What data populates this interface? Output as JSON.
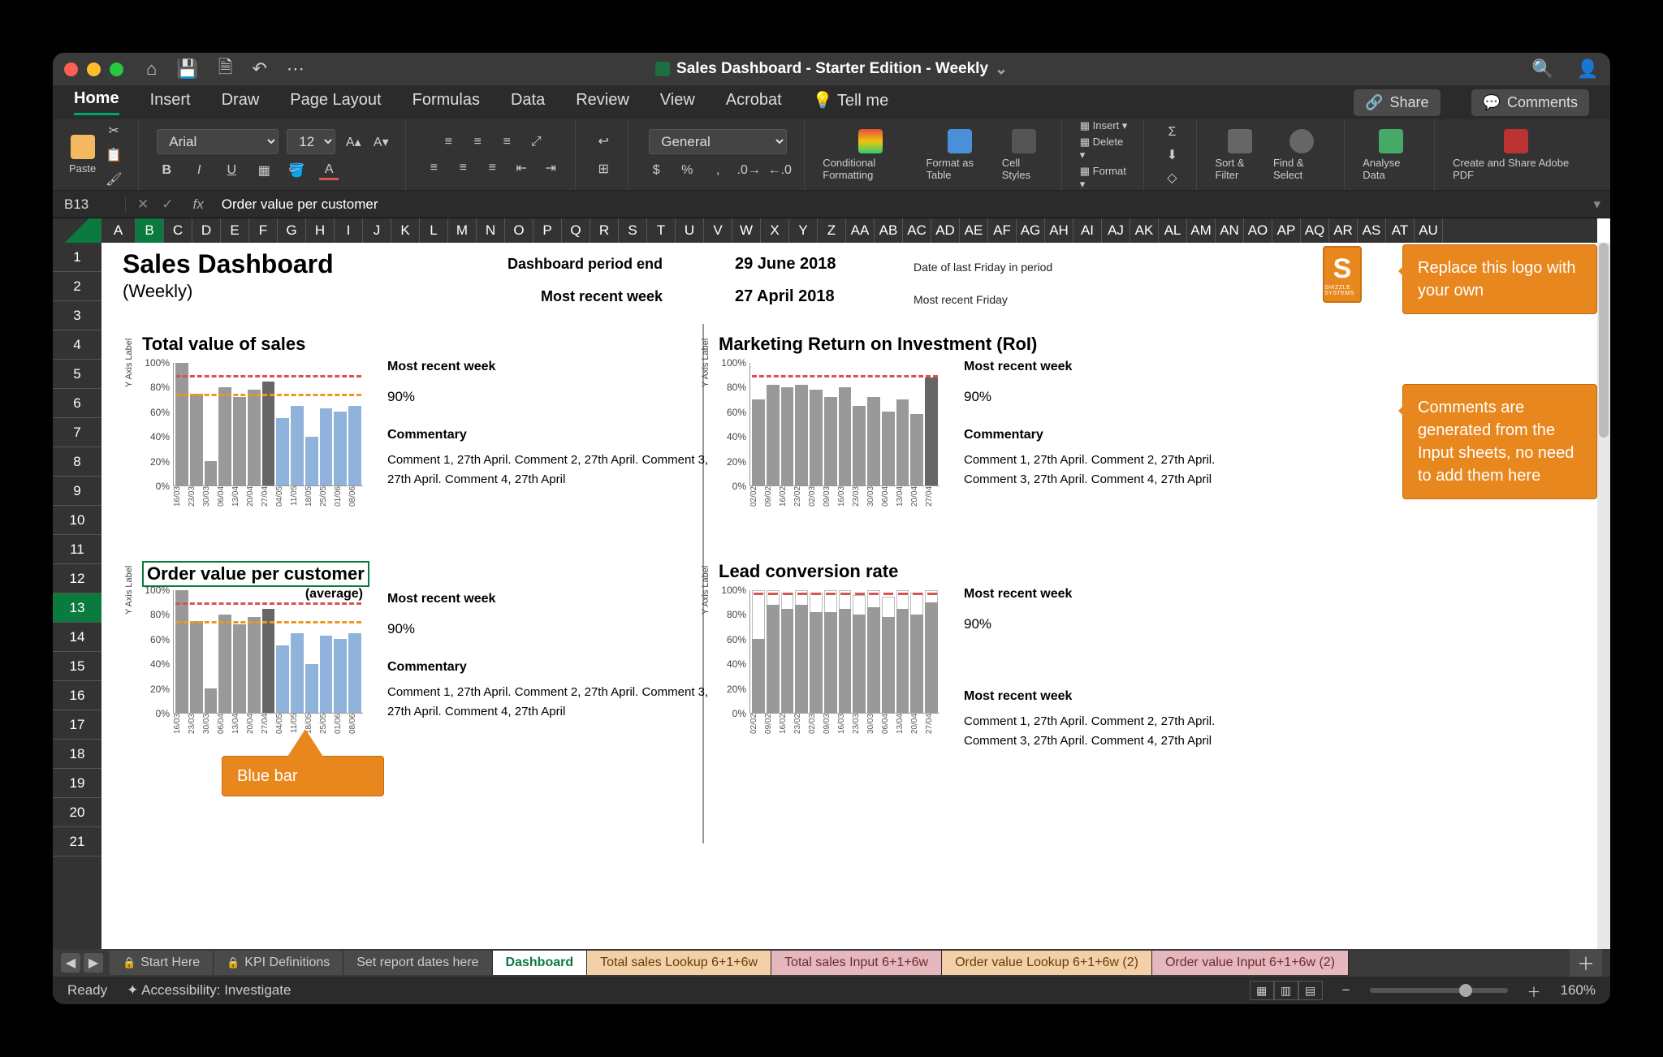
{
  "title": "Sales Dashboard - Starter Edition - Weekly",
  "tabs": [
    "Home",
    "Insert",
    "Draw",
    "Page Layout",
    "Formulas",
    "Data",
    "Review",
    "View",
    "Acrobat",
    "Tell me"
  ],
  "activeTab": "Home",
  "share": "Share",
  "comments": "Comments",
  "font": {
    "name": "Arial",
    "size": "12"
  },
  "numfmt": "General",
  "ribbon": {
    "paste": "Paste",
    "cond": "Conditional Formatting",
    "fat": "Format as Table",
    "cell": "Cell Styles",
    "insert": "Insert",
    "delete": "Delete",
    "format": "Format",
    "sort": "Sort & Filter",
    "find": "Find & Select",
    "analyse": "Analyse Data",
    "pdf": "Create and Share Adobe PDF"
  },
  "cellref": "B13",
  "formula": "Order value per customer",
  "cols": [
    "A",
    "B",
    "C",
    "D",
    "E",
    "F",
    "G",
    "H",
    "I",
    "J",
    "K",
    "L",
    "M",
    "N",
    "O",
    "P",
    "Q",
    "R",
    "S",
    "T",
    "U",
    "V",
    "W",
    "X",
    "Y",
    "Z",
    "AA",
    "AB",
    "AC",
    "AD",
    "AE",
    "AF",
    "AG",
    "AH",
    "AI",
    "AJ",
    "AK",
    "AL",
    "AM",
    "AN",
    "AO",
    "AP",
    "AQ",
    "AR",
    "AS",
    "AT",
    "AU"
  ],
  "rows": [
    "1",
    "2",
    "3",
    "4",
    "5",
    "6",
    "7",
    "8",
    "9",
    "10",
    "11",
    "12",
    "13",
    "14",
    "15",
    "16",
    "17",
    "18",
    "19",
    "20",
    "21"
  ],
  "selrow": "13",
  "dash": {
    "title": "Sales Dashboard",
    "subtitle": "(Weekly)",
    "meta1l": "Dashboard period end",
    "meta1v": "29 June 2018",
    "meta1n": "Date of last Friday in period",
    "meta2l": "Most recent week",
    "meta2v": "27 April 2018",
    "meta2n": "Most recent Friday",
    "mrw": "Most recent week",
    "pct": "90%",
    "cmh": "Commentary",
    "cmt": "Comment 1, 27th April. Comment 2,  27th April. Comment 3,  27th April. Comment 4,  27th April",
    "p1": "Total value of sales",
    "p2": "Marketing Return on Investment (RoI)",
    "p3": "Order value per customer",
    "p3s": "(average)",
    "p4": "Lead conversion rate",
    "ylab": "Y Axis Label",
    "callout_logo": "Replace this logo with your own",
    "callout_cm": "Comments are generated from the Input sheets, no need to add them here",
    "callout_blue": "Blue bar"
  },
  "chart_data": [
    {
      "id": "total_sales",
      "type": "bar",
      "title": "Total value of sales",
      "ylabel": "Y Axis Label",
      "ylim": [
        0,
        100
      ],
      "categories": [
        "16/03",
        "23/03",
        "30/03",
        "06/04",
        "13/04",
        "20/04",
        "27/04",
        "04/05",
        "11/05",
        "18/05",
        "25/05",
        "01/06",
        "08/06"
      ],
      "values": [
        100,
        75,
        20,
        80,
        72,
        78,
        85,
        55,
        65,
        40,
        63,
        60,
        65
      ],
      "forecast_start_index": 7,
      "target_line": 90,
      "mid_line": 75
    },
    {
      "id": "roi",
      "type": "bar",
      "title": "Marketing Return on Investment (RoI)",
      "ylabel": "Y Axis Label",
      "ylim": [
        0,
        100
      ],
      "categories": [
        "02/02",
        "09/02",
        "16/02",
        "23/02",
        "02/03",
        "09/03",
        "16/03",
        "23/03",
        "30/03",
        "06/04",
        "13/04",
        "20/04",
        "27/04"
      ],
      "values": [
        70,
        82,
        80,
        82,
        78,
        72,
        80,
        65,
        72,
        60,
        70,
        58,
        88
      ],
      "target_line": 90
    },
    {
      "id": "order_value",
      "type": "bar",
      "title": "Order value per customer (average)",
      "ylabel": "Y Axis Label",
      "ylim": [
        0,
        100
      ],
      "categories": [
        "16/03",
        "23/03",
        "30/03",
        "06/04",
        "13/04",
        "20/04",
        "27/04",
        "04/05",
        "11/05",
        "18/05",
        "25/05",
        "01/06",
        "08/06"
      ],
      "values": [
        100,
        75,
        20,
        80,
        72,
        78,
        85,
        55,
        65,
        40,
        63,
        60,
        65
      ],
      "forecast_start_index": 7,
      "target_line": 90,
      "mid_line": 75
    },
    {
      "id": "lead_conv",
      "type": "bar",
      "title": "Lead conversion rate",
      "ylabel": "Y Axis Label",
      "ylim": [
        0,
        100
      ],
      "categories": [
        "02/02",
        "09/02",
        "16/02",
        "23/02",
        "02/03",
        "09/03",
        "16/03",
        "23/03",
        "30/03",
        "06/04",
        "13/04",
        "20/04",
        "27/04"
      ],
      "values": [
        60,
        88,
        85,
        88,
        82,
        82,
        85,
        80,
        86,
        78,
        85,
        80,
        90
      ],
      "series2": [
        100,
        100,
        98,
        100,
        98,
        100,
        100,
        96,
        100,
        95,
        100,
        98,
        100
      ],
      "target_line": 98
    }
  ],
  "sheets": [
    {
      "label": "Start Here",
      "lock": true
    },
    {
      "label": "KPI Definitions",
      "lock": true
    },
    {
      "label": "Set report dates here"
    },
    {
      "label": "Dashboard",
      "active": true
    },
    {
      "label": "Total sales Lookup 6+1+6w",
      "cls": "peach"
    },
    {
      "label": "Total sales Input  6+1+6w",
      "cls": "pink"
    },
    {
      "label": "Order value Lookup 6+1+6w (2)",
      "cls": "peach"
    },
    {
      "label": "Order value Input  6+1+6w (2)",
      "cls": "pink"
    }
  ],
  "status": {
    "ready": "Ready",
    "acc": "Accessibility: Investigate",
    "zoom": "160%"
  }
}
